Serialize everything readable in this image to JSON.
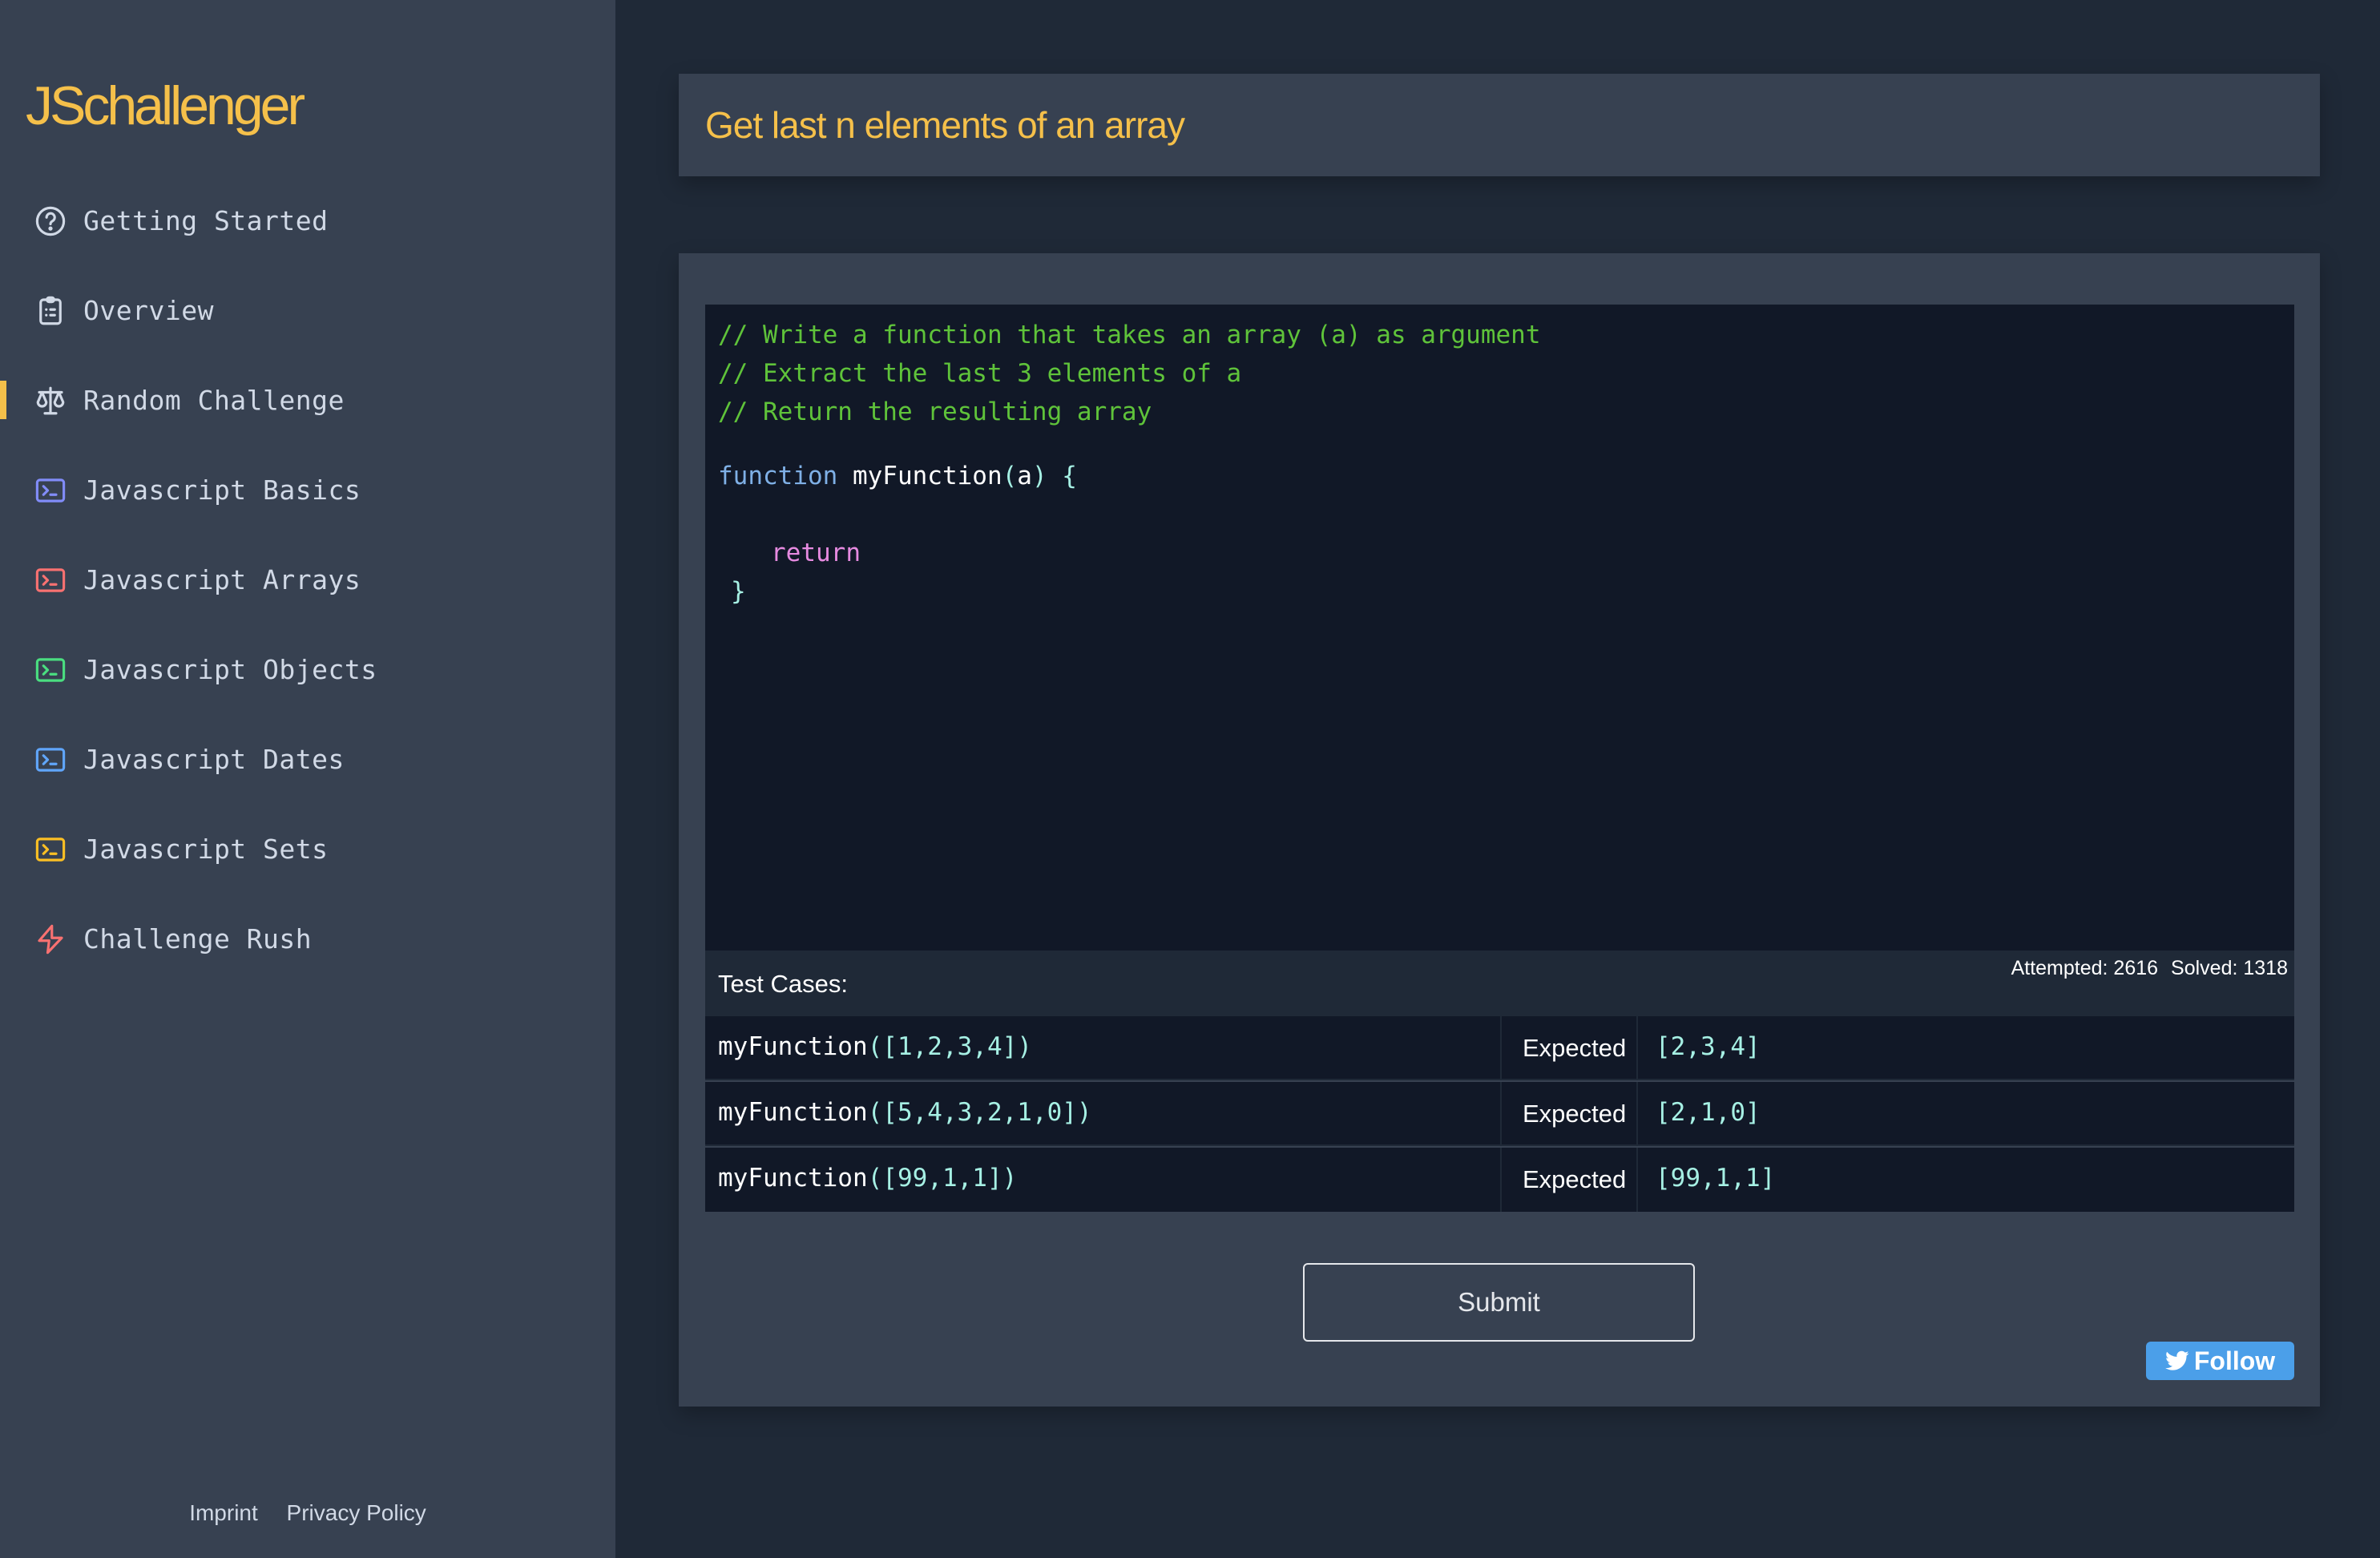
{
  "app": {
    "logo": "JSchallenger"
  },
  "sidebar": {
    "items": [
      {
        "label": "Getting Started",
        "icon": "question-circle-icon",
        "color": "#d1d9e6",
        "active": false
      },
      {
        "label": "Overview",
        "icon": "clipboard-list-icon",
        "color": "#d1d9e6",
        "active": false
      },
      {
        "label": "Random Challenge",
        "icon": "scale-icon",
        "color": "#d1d9e6",
        "active": true
      },
      {
        "label": "Javascript Basics",
        "icon": "terminal-icon",
        "color": "#818cf8",
        "active": false
      },
      {
        "label": "Javascript Arrays",
        "icon": "terminal-icon",
        "color": "#f87171",
        "active": false
      },
      {
        "label": "Javascript Objects",
        "icon": "terminal-icon",
        "color": "#4ade80",
        "active": false
      },
      {
        "label": "Javascript Dates",
        "icon": "terminal-icon",
        "color": "#60a5fa",
        "active": false
      },
      {
        "label": "Javascript Sets",
        "icon": "terminal-icon",
        "color": "#fbbf24",
        "active": false
      },
      {
        "label": "Challenge Rush",
        "icon": "lightning-icon",
        "color": "#f87171",
        "active": false
      }
    ],
    "footer": {
      "imprint": "Imprint",
      "privacy": "Privacy Policy"
    }
  },
  "challenge": {
    "title": "Get last n elements of an array",
    "code": {
      "comment1": "// Write a function that takes an array (a) as argument",
      "comment2": "// Extract the last 3 elements of a",
      "comment3": "// Return the resulting array",
      "keyword": "function",
      "fn_name": "myFunction",
      "open_paren": "(",
      "param": "a",
      "close_paren_brace": ") {",
      "return_kw": "return",
      "close_brace": "}"
    },
    "tests": {
      "label": "Test Cases:",
      "attempted": "Attempted: 2616",
      "solved": "Solved: 1318",
      "rows": [
        {
          "fn": "myFunction",
          "arg": "([1,2,3,4])",
          "expected_label": "Expected",
          "expected": "[2,3,4]"
        },
        {
          "fn": "myFunction",
          "arg": "([5,4,3,2,1,0])",
          "expected_label": "Expected",
          "expected": "[2,1,0]"
        },
        {
          "fn": "myFunction",
          "arg": "([99,1,1])",
          "expected_label": "Expected",
          "expected": "[99,1,1]"
        }
      ]
    },
    "submit_label": "Submit",
    "follow_label": "Follow"
  },
  "colors": {
    "accent": "#f5c04a",
    "sidebar_bg": "#374151",
    "main_bg": "#1f2937",
    "editor_bg": "#111827",
    "twitter": "#4b9fe9"
  }
}
